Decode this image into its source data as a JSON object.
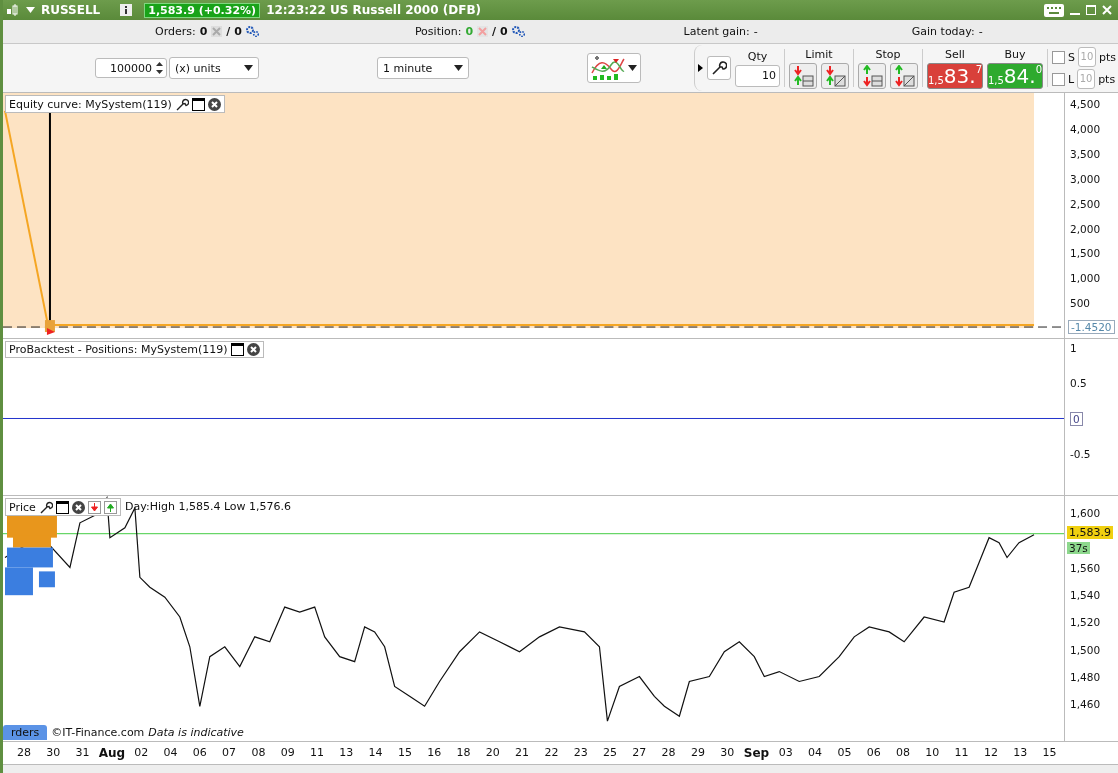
{
  "title_bar": {
    "symbol": "RUSSELL",
    "price_change": "1,583.9 (+0.32%)",
    "description": "12:23:22 US Russell 2000 (DFB)"
  },
  "info_bar": {
    "orders_label": "Orders:",
    "orders_count": "0",
    "orders_total": "/ 0",
    "position_label": "Position:",
    "position_count": "0",
    "position_total": "/ 0",
    "latent_gain_label": "Latent gain:",
    "latent_gain": "-",
    "gain_today_label": "Gain today:",
    "gain_today": "-"
  },
  "toolbar": {
    "quantity": "100000",
    "unit": "(x) units",
    "timeframe": "1 minute"
  },
  "trade_panel": {
    "qty_label": "Qty",
    "qty": "10",
    "limit_label": "Limit",
    "stop_label": "Stop",
    "sell": {
      "label": "Sell",
      "prefix": "1,5",
      "main": "83.",
      "suffix": "7"
    },
    "buy": {
      "label": "Buy",
      "prefix": "1,5",
      "main": "84.",
      "suffix": "0"
    },
    "stops": [
      {
        "label": "S",
        "checked": false,
        "value": "10",
        "unit": "pts",
        "disabled": true
      },
      {
        "label": "L",
        "checked": false,
        "value": "10",
        "unit": "pts",
        "disabled": true
      }
    ]
  },
  "equity_panel": {
    "title": "Equity curve: MySystem(119)",
    "yticks": [
      "4,500",
      "4,000",
      "3,500",
      "3,000",
      "2,500",
      "2,000",
      "1,500",
      "1,000",
      "500"
    ],
    "current": "-1.4520"
  },
  "positions_panel": {
    "title": "ProBacktest - Positions: MySystem(119)",
    "yticks": [
      "1",
      "0.5",
      "0",
      "-0.5"
    ]
  },
  "price_panel": {
    "title": "Price",
    "day_range": "Day:High 1,585.4 Low 1,576.6",
    "yticks": [
      "1,600",
      "1,560",
      "1,540",
      "1,520",
      "1,500",
      "1,480",
      "1,460"
    ],
    "last_price": "1,583.9",
    "countdown": "37s",
    "tab": "rders",
    "copyright": "©IT-Finance.com",
    "disclaimer": "Data is indicative"
  },
  "x_axis": [
    {
      "label": "28",
      "major": false
    },
    {
      "label": "30",
      "major": false
    },
    {
      "label": "31",
      "major": false
    },
    {
      "label": "Aug",
      "major": true
    },
    {
      "label": "02",
      "major": false
    },
    {
      "label": "04",
      "major": false
    },
    {
      "label": "06",
      "major": false
    },
    {
      "label": "07",
      "major": false
    },
    {
      "label": "08",
      "major": false
    },
    {
      "label": "09",
      "major": false
    },
    {
      "label": "11",
      "major": false
    },
    {
      "label": "13",
      "major": false
    },
    {
      "label": "14",
      "major": false
    },
    {
      "label": "15",
      "major": false
    },
    {
      "label": "16",
      "major": false
    },
    {
      "label": "18",
      "major": false
    },
    {
      "label": "20",
      "major": false
    },
    {
      "label": "21",
      "major": false
    },
    {
      "label": "22",
      "major": false
    },
    {
      "label": "23",
      "major": false
    },
    {
      "label": "25",
      "major": false
    },
    {
      "label": "27",
      "major": false
    },
    {
      "label": "28",
      "major": false
    },
    {
      "label": "29",
      "major": false
    },
    {
      "label": "30",
      "major": false
    },
    {
      "label": "Sep",
      "major": true
    },
    {
      "label": "03",
      "major": false
    },
    {
      "label": "04",
      "major": false
    },
    {
      "label": "05",
      "major": false
    },
    {
      "label": "06",
      "major": false
    },
    {
      "label": "08",
      "major": false
    },
    {
      "label": "10",
      "major": false
    },
    {
      "label": "11",
      "major": false
    },
    {
      "label": "12",
      "major": false
    },
    {
      "label": "13",
      "major": false
    },
    {
      "label": "15",
      "major": false
    }
  ]
}
